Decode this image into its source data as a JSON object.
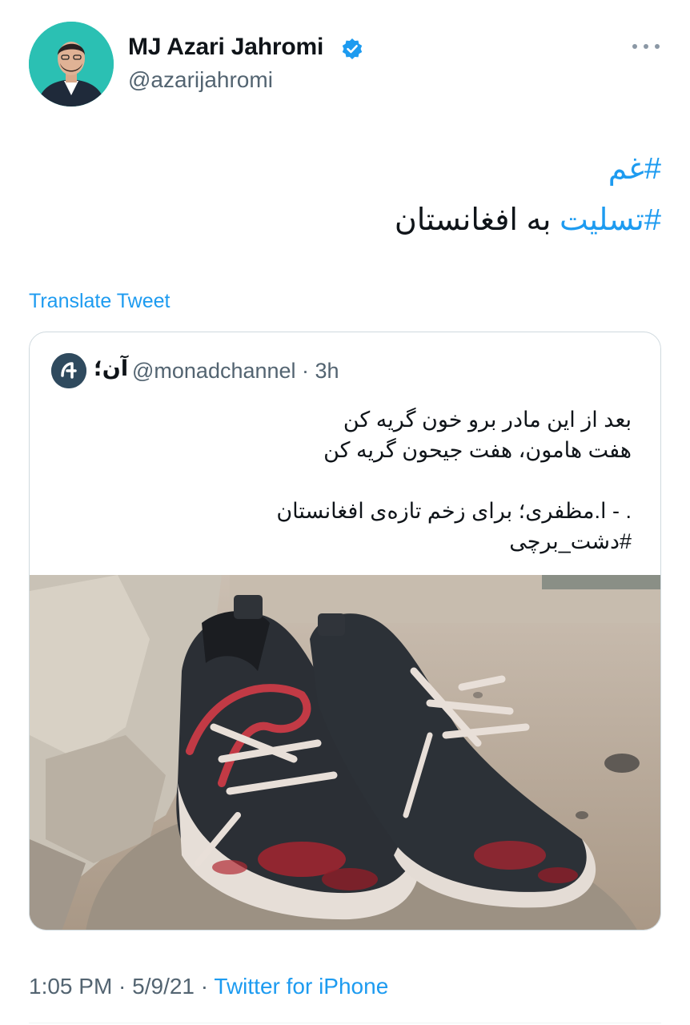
{
  "author": {
    "name": "MJ Azari Jahromi",
    "handle": "@azarijahromi"
  },
  "tweet": {
    "hashtag1": "#غم",
    "hashtag2": "#تسلیت",
    "line2_rest": " به افغانستان"
  },
  "translate_label": "Translate Tweet",
  "quote": {
    "name": "آن؛",
    "handle": "@monadchannel · 3h",
    "lines": [
      "بعد از این مادر برو خون گریه کن",
      "هفت هامون، هفت جیحون گریه کن",
      ". - ا.مظفری؛ برای زخم تازه‌ی افغانستان",
      "#دشت_برچی"
    ]
  },
  "footer": {
    "time_date": "1:05 PM · 5/9/21 · ",
    "source": "Twitter for iPhone"
  },
  "colors": {
    "accent": "#1d9bf0",
    "secondary_text": "#536471",
    "avatar_bg": "#2bc0b3"
  },
  "icons": [
    "verified-badge-icon",
    "more-options-icon",
    "shoes-photo"
  ]
}
